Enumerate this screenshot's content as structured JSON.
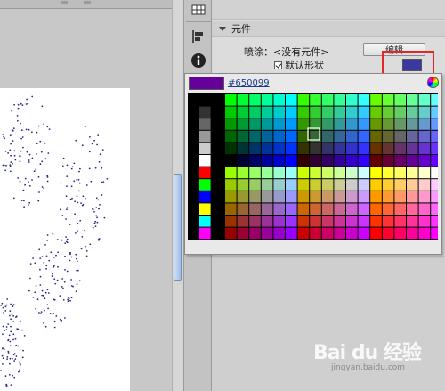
{
  "panel": {
    "section_title": "元件",
    "instance_label": "喷涂：",
    "instance_value": "<没有元件>",
    "edit_button": "编辑",
    "default_shape_label": "默认形状",
    "default_shape_checked": true,
    "fill_color": "#3a3a9e"
  },
  "color_picker": {
    "hex_value": "#650099",
    "preview_color": "#650099",
    "left_column_colors": [
      "#000000",
      "#333333",
      "#666666",
      "#999999",
      "#cccccc",
      "#ffffff",
      "#ff0000",
      "#00ff00",
      "#0000ff",
      "#ffff00",
      "#00ffff",
      "#ff00ff"
    ]
  },
  "watermark": {
    "brand": "Bai du 经验",
    "url": "jingyan.baidu.com"
  },
  "colors": {
    "highlight": "#e0282c",
    "spray_dots": "#2a2a8a"
  }
}
